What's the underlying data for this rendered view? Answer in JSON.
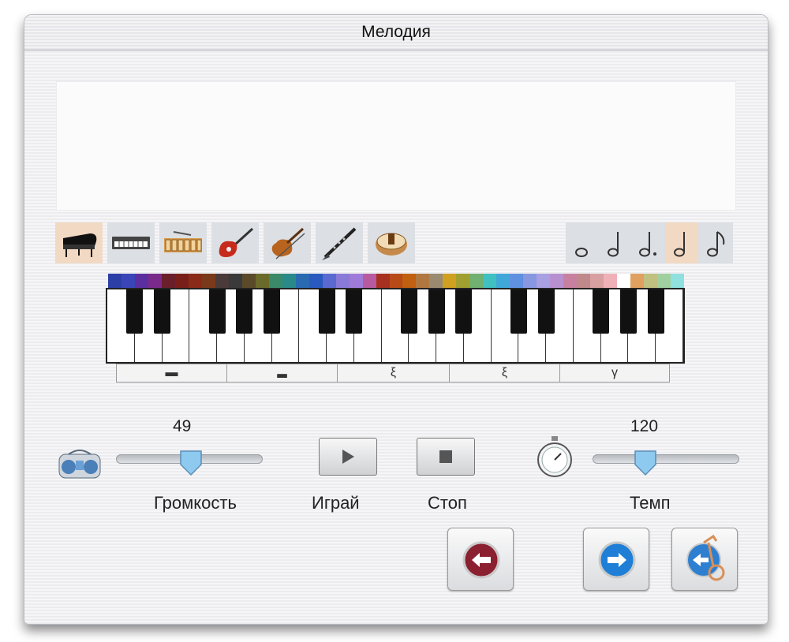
{
  "window": {
    "title": "Мелодия"
  },
  "instruments": [
    {
      "name": "piano-icon",
      "selected": true
    },
    {
      "name": "synthesizer-icon",
      "selected": false
    },
    {
      "name": "xylophone-icon",
      "selected": false
    },
    {
      "name": "electric-guitar-icon",
      "selected": false
    },
    {
      "name": "violin-icon",
      "selected": false
    },
    {
      "name": "clarinet-icon",
      "selected": false
    },
    {
      "name": "drum-icon",
      "selected": false
    }
  ],
  "durations": [
    {
      "name": "whole-note-icon",
      "selected": false
    },
    {
      "name": "half-note-icon",
      "selected": false
    },
    {
      "name": "dotted-half-note-icon",
      "selected": false
    },
    {
      "name": "quarter-note-icon",
      "selected": true
    },
    {
      "name": "eighth-note-icon",
      "selected": false
    }
  ],
  "rests": [
    "whole-rest-icon",
    "half-rest-icon",
    "quarter-rest-icon",
    "quarter-rest-icon",
    "eighth-rest-icon"
  ],
  "volume": {
    "value": "49",
    "label": "Громкость",
    "level": 0.49,
    "icon": "boombox-icon"
  },
  "play": {
    "label": "Играй",
    "icon": "play-icon"
  },
  "stop": {
    "label": "Стоп",
    "icon": "stop-icon"
  },
  "tempo": {
    "value": "120",
    "label": "Темп",
    "icon": "stopwatch-icon"
  },
  "nav": {
    "back": "back-arrow-icon",
    "forward": "forward-arrow-icon",
    "exit": "exit-key-icon"
  },
  "colors": {
    "selected_bg": "#f2d9c3",
    "tile_bg": "#dcdfe3",
    "thumb": "#8ec9ef",
    "back_red": "#8b2030",
    "forward_blue": "#1f7fd6"
  }
}
